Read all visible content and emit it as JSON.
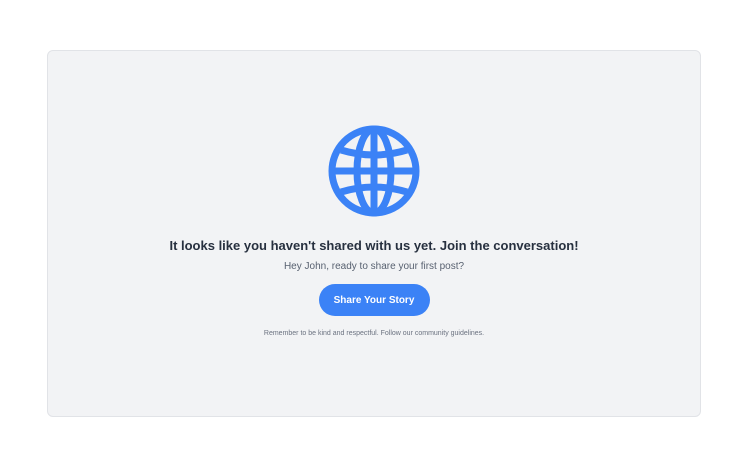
{
  "empty_state": {
    "icon": "globe-icon",
    "headline": "It looks like you haven't shared with us yet. Join the conversation!",
    "subtext": "Hey John, ready to share your first post?",
    "cta_label": "Share Your Story",
    "footnote": "Remember to be kind and respectful. Follow our community guidelines."
  },
  "colors": {
    "accent": "#3b82f6",
    "card_background": "#f2f3f5",
    "headline_text": "#27303f",
    "muted_text": "#6b7280"
  }
}
